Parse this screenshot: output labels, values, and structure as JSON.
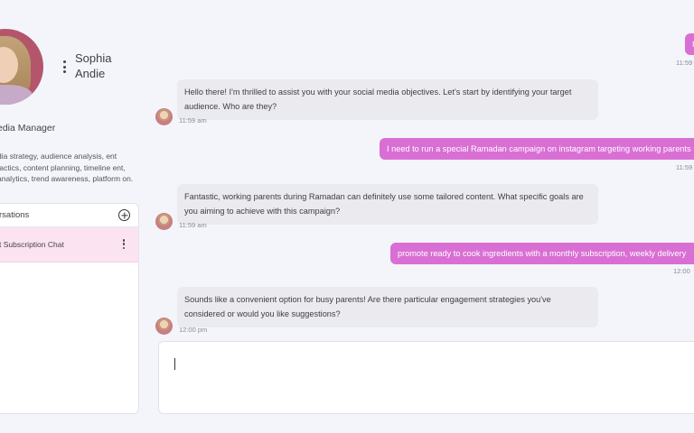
{
  "profile": {
    "name": "Sophia Andie",
    "role": "edia Manager",
    "skills": "dia strategy, audience analysis, ent tactics, content planning, timeline ent, analytics, trend awareness, platform on."
  },
  "conversations": {
    "title": "rsations",
    "items": [
      {
        "label": "t Subscription Chat"
      }
    ]
  },
  "messages": [
    {
      "from": "user",
      "text": "H",
      "time": "11:59"
    },
    {
      "from": "bot",
      "text": "Hello there! I'm thrilled to assist you with your social media objectives. Let's start by identifying your target audience. Who are they?",
      "time": "11:59 am"
    },
    {
      "from": "user",
      "text": "I need to run a special Ramadan campaign on instagram targeting working parents",
      "time": "11:59"
    },
    {
      "from": "bot",
      "text": "Fantastic, working parents during Ramadan can definitely use some tailored content. What specific goals are you aiming to achieve with this campaign?",
      "time": "11:59 am"
    },
    {
      "from": "user",
      "text": "promote ready to cook ingredients with a monthly subscription, weekly delivery",
      "time": "12:00"
    },
    {
      "from": "bot",
      "text": "Sounds like a convenient option for busy parents! Are there particular engagement strategies you've considered or would you like suggestions?",
      "time": "12:00 pm"
    }
  ],
  "composer": {
    "value": ""
  },
  "colors": {
    "accent": "#d96fd4",
    "conversation_active": "#fbe3f2",
    "background": "#f4f5fa"
  },
  "icons": {
    "add": "plus-circle-icon",
    "menu": "kebab-menu-icon"
  }
}
